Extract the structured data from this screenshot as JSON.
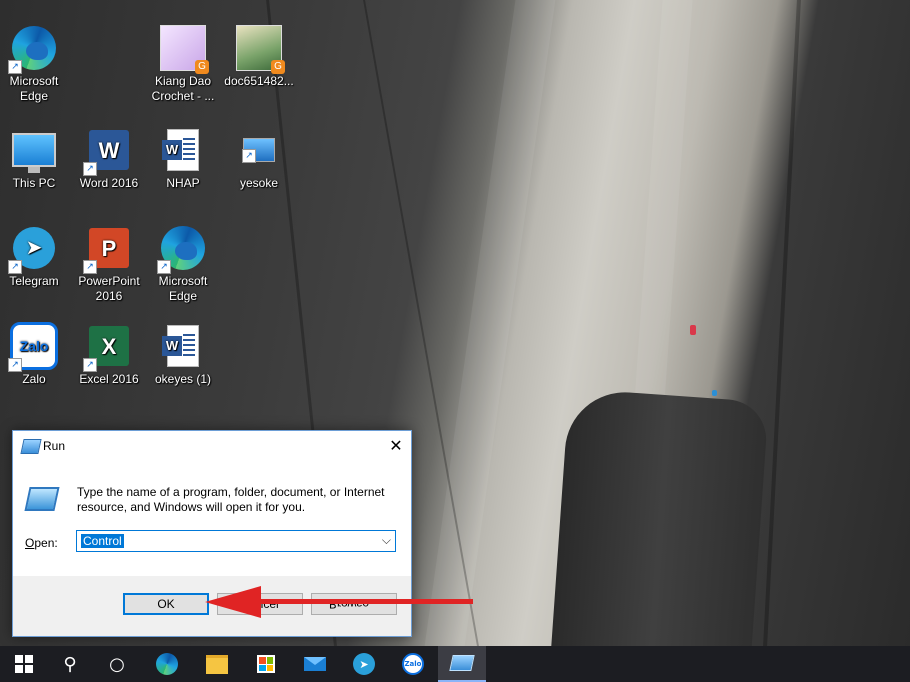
{
  "desktop": {
    "icons": [
      {
        "label": "Microsoft Edge",
        "line1": "Microsoft",
        "line2": "Edge",
        "icon": "edge-icon"
      },
      {
        "label": "Kiang Dao Crochet - ...",
        "line1": "Kiang Dao",
        "line2": "Crochet - ...",
        "icon": "image-thumbnail-icon"
      },
      {
        "label": "doc651482...",
        "line1": "doc651482...",
        "line2": "",
        "icon": "image-thumbnail-icon"
      },
      {
        "label": "This PC",
        "line1": "This PC",
        "line2": "",
        "icon": "computer-icon"
      },
      {
        "label": "Word 2016",
        "line1": "Word 2016",
        "line2": "",
        "icon": "word-icon"
      },
      {
        "label": "NHAP",
        "line1": "NHAP",
        "line2": "",
        "icon": "word-document-icon"
      },
      {
        "label": "yesoke",
        "line1": "yesoke",
        "line2": "",
        "icon": "shortcut-icon"
      },
      {
        "label": "Telegram",
        "line1": "Telegram",
        "line2": "",
        "icon": "telegram-icon"
      },
      {
        "label": "PowerPoint 2016",
        "line1": "PowerPoint",
        "line2": "2016",
        "icon": "powerpoint-icon"
      },
      {
        "label": "Microsoft Edge",
        "line1": "Microsoft",
        "line2": "Edge",
        "icon": "edge-icon"
      },
      {
        "label": "Zalo",
        "line1": "Zalo",
        "line2": "",
        "icon": "zalo-icon"
      },
      {
        "label": "Excel 2016",
        "line1": "Excel 2016",
        "line2": "",
        "icon": "excel-icon"
      },
      {
        "label": "okeyes (1)",
        "line1": "okeyes (1)",
        "line2": "",
        "icon": "word-document-icon"
      }
    ]
  },
  "run_dialog": {
    "title": "Run",
    "close_glyph": "✕",
    "description": "Type the name of a program, folder, document, or Internet resource, and Windows will open it for you.",
    "open_label_key": "O",
    "open_label_rest": "pen:",
    "open_value": "Control",
    "ok_label": "OK",
    "cancel_label": "Cancel",
    "browse_label": "Browse..."
  },
  "icon_glyphs": {
    "word": "W",
    "powerpoint": "P",
    "excel": "X",
    "zalo": "Zalo",
    "telegram": "➤",
    "shortcut": "↗",
    "badge": "G",
    "chevron": "⌵",
    "search": "⚲",
    "taskview": "○"
  },
  "taskbar": {
    "items": [
      "start",
      "search",
      "task-view",
      "edge",
      "file-explorer",
      "store",
      "mail",
      "telegram",
      "zalo",
      "run"
    ],
    "zalo_label": "Zalo"
  },
  "colors": {
    "accent": "#0078d7",
    "arrow": "#e02424",
    "taskbar": "#1c1d22"
  }
}
